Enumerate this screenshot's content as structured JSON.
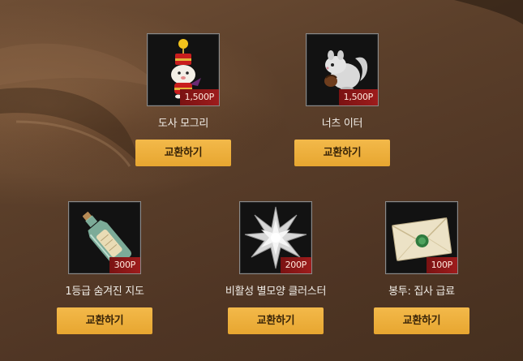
{
  "exchange_button_label": "교환하기",
  "items": [
    {
      "name": "도사 모그리",
      "price": "1,500P",
      "icon": "mog-doll-icon"
    },
    {
      "name": "너츠 이터",
      "price": "1,500P",
      "icon": "nut-eater-squirrel-icon"
    },
    {
      "name": "1등급 숨겨진 지도",
      "price": "300P",
      "icon": "message-bottle-map-icon"
    },
    {
      "name": "비활성 별모양 클러스터",
      "price": "200P",
      "icon": "star-cluster-icon"
    },
    {
      "name": "봉투: 집사 급료",
      "price": "100P",
      "icon": "sealed-envelope-icon"
    }
  ],
  "colors": {
    "button": "#e9a833",
    "price_badge": "#8a1717",
    "background": "#5a3e2a"
  }
}
